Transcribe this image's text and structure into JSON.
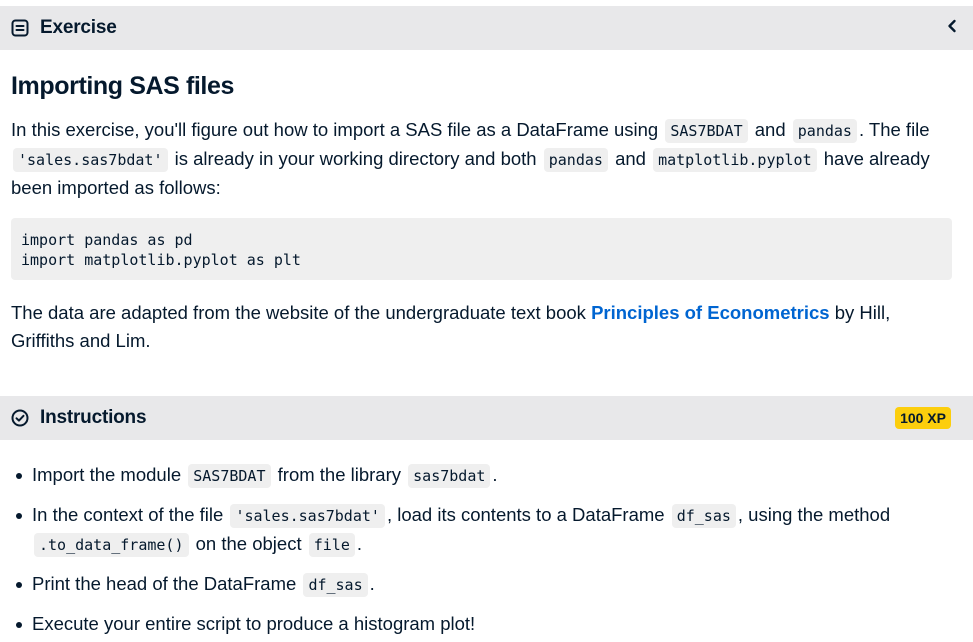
{
  "exercise": {
    "header_label": "Exercise",
    "title": "Importing SAS files",
    "intro": {
      "t1": "In this exercise, you'll figure out how to import a SAS file as a DataFrame using ",
      "c1": "SAS7BDAT",
      "t2": " and ",
      "c2": "pandas",
      "t3": ". The file ",
      "c3": "'sales.sas7bdat'",
      "t4": " is already in your working directory and both ",
      "c4": "pandas",
      "t5": " and ",
      "c5": "matplotlib.pyplot",
      "t6": " have already been imported as follows:"
    },
    "code_block": "import pandas as pd\nimport matplotlib.pyplot as plt",
    "source": {
      "t1": "The data are adapted from the website of the undergraduate text book ",
      "link": "Principles of Econometrics",
      "t2": " by Hill, Griffiths and Lim."
    }
  },
  "instructions": {
    "header_label": "Instructions",
    "xp_badge": "100 XP",
    "items": [
      {
        "t1": "Import the module ",
        "c1": "SAS7BDAT",
        "t2": " from the library ",
        "c2": "sas7bdat",
        "t3": "."
      },
      {
        "t1": "In the context of the file ",
        "c1": "'sales.sas7bdat'",
        "t2": ", load its contents to a DataFrame ",
        "c2": "df_sas",
        "t3": ", using the method ",
        "c3": ".to_data_frame()",
        "t4": " on the object ",
        "c4": "file",
        "t5": "."
      },
      {
        "t1": "Print the head of the DataFrame ",
        "c1": "df_sas",
        "t2": "."
      },
      {
        "t1": "Execute your entire script to produce a histogram plot!"
      }
    ]
  },
  "icons": {
    "exercise": "document-icon",
    "instructions": "check-circle-icon",
    "collapse": "chevron-left-icon"
  },
  "colors": {
    "header_bg": "#e8e8ea",
    "text": "#05192d",
    "link": "#0065d1",
    "xp_badge": "#fcce0d",
    "code_bg": "#efefef"
  }
}
